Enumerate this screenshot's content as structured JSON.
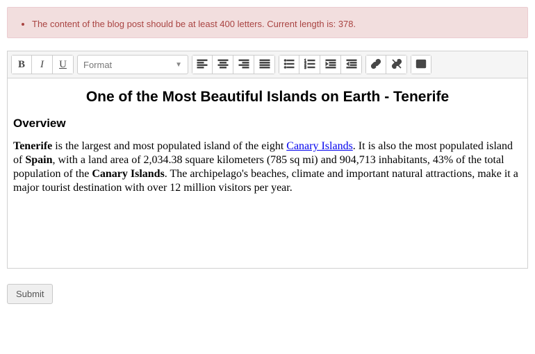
{
  "error": {
    "message": "The content of the blog post should be at least 400 letters. Current length is: 378."
  },
  "toolbar": {
    "bold_label": "B",
    "italic_label": "I",
    "underline_label": "U",
    "format_label": "Format"
  },
  "content": {
    "title": "One of the Most Beautiful Islands on Earth - Tenerife",
    "section_heading": "Overview",
    "p1_b1": "Tenerife",
    "p1_t1": " is the largest and most populated island of the eight ",
    "p1_link_text": "Canary Islands",
    "p1_t2": ". It is also the most populated island of ",
    "p1_b2": "Spain",
    "p1_t3": ", with a land area of 2,034.38 square kilometers (785 sq mi) and 904,713 inhabitants, 43% of the total population of the ",
    "p1_b3": "Canary Islands",
    "p1_t4": ". The archipelago's beaches, climate and important natural attractions, make it a major tourist destination with over 12 million visitors per year."
  },
  "submit_label": "Submit"
}
